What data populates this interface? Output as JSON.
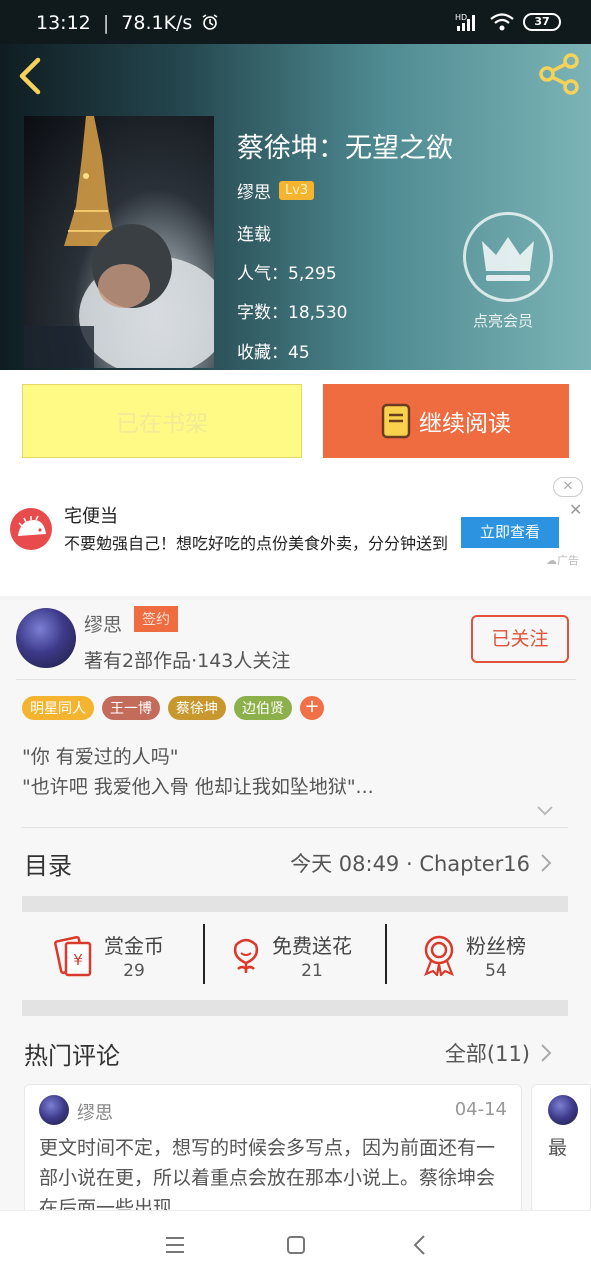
{
  "status_bar": {
    "time": "13:12",
    "speed": "78.1K/s",
    "signal": "HD",
    "battery": "37"
  },
  "book": {
    "title": "蔡徐坤：无望之欲",
    "author": "缪思",
    "author_level": "Lv3",
    "status": "连载",
    "popularity": "人气：5,295",
    "word_count": "字数：18,530",
    "favorites": "收藏：45"
  },
  "vip": {
    "label": "点亮会员",
    "icon": "crown-icon"
  },
  "actions": {
    "shelf_label": "已在书架",
    "read_label": "继续阅读"
  },
  "ad": {
    "title": "宅便当",
    "description": "不要勉强自己！想吃好吃的点份美食外卖，分分钟送到",
    "cta": "立即查看",
    "tag": "广告"
  },
  "author_card": {
    "name": "缪思",
    "badge": "签约",
    "stats": "著有2部作品·143人关注",
    "follow_label": "已关注"
  },
  "tags": [
    {
      "label": "明星同人",
      "color": "#f4b42f"
    },
    {
      "label": "王一博",
      "color": "#c46c5c"
    },
    {
      "label": "蔡徐坤",
      "color": "#c8982f"
    },
    {
      "label": "边伯贤",
      "color": "#8cb04a"
    }
  ],
  "intro": {
    "line1": "\"你 有爱过的人吗\"",
    "line2": "\"也许吧 我爱他入骨 他却让我如坠地狱\"..."
  },
  "toc": {
    "label": "目录",
    "latest": "今天 08:49 · Chapter16"
  },
  "rewards": [
    {
      "label": "赏金币",
      "value": "29",
      "icon": "red-envelope-icon"
    },
    {
      "label": "免费送花",
      "value": "21",
      "icon": "flower-icon"
    },
    {
      "label": "粉丝榜",
      "value": "54",
      "icon": "medal-icon"
    }
  ],
  "comments_section": {
    "label": "热门评论",
    "all_label": "全部(11)"
  },
  "comments": [
    {
      "author": "缪思",
      "date": "04-14",
      "text": "更文时间不定，想写的时候会多写点，因为前面还有一部小说在更，所以着重点会放在那本小说上。蔡徐坤会在后面一些出现"
    },
    {
      "text": "最"
    }
  ],
  "colors": {
    "accent": "#ef6b40",
    "shelf": "#fff985",
    "follow": "#e0523a",
    "ad_cta": "#2b93e0"
  }
}
